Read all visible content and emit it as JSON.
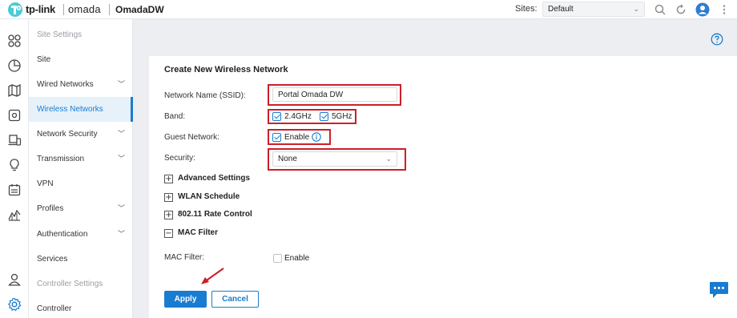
{
  "header": {
    "brand_tplink": "tp-link",
    "brand_omada": "omada",
    "site_name": "OmadaDW",
    "sites_label": "Sites:",
    "sites_value": "Default",
    "icons": [
      "search-icon",
      "refresh-icon",
      "user-avatar",
      "more-vertical-icon"
    ]
  },
  "rail": {
    "icons": [
      "dashboard-icon",
      "statistics-icon",
      "map-icon",
      "devices-icon",
      "clients-icon",
      "insights-icon",
      "logs-icon",
      "reports-icon",
      "account-icon",
      "settings-icon"
    ]
  },
  "subnav": {
    "items": [
      {
        "label": "Site Settings",
        "muted": true
      },
      {
        "label": "Site"
      },
      {
        "label": "Wired Networks",
        "chevron": "﹀"
      },
      {
        "label": "Wireless Networks",
        "active": true
      },
      {
        "label": "Network Security",
        "chevron": "﹀"
      },
      {
        "label": "Transmission",
        "chevron": "﹀"
      },
      {
        "label": "VPN"
      },
      {
        "label": "Profiles",
        "chevron": "﹀"
      },
      {
        "label": "Authentication",
        "chevron": "﹀"
      },
      {
        "label": "Services"
      },
      {
        "label": "Controller Settings",
        "muted": true
      },
      {
        "label": "Controller"
      }
    ]
  },
  "form": {
    "title": "Create New Wireless Network",
    "ssid_label": "Network Name (SSID):",
    "ssid_value": "Portal Omada DW",
    "band_label": "Band:",
    "band_24": "2.4GHz",
    "band_5": "5GHz",
    "guest_label": "Guest Network:",
    "guest_enable": "Enable",
    "security_label": "Security:",
    "security_value": "None",
    "sections": [
      {
        "label": "Advanced Settings",
        "sign": "+"
      },
      {
        "label": "WLAN Schedule",
        "sign": "+"
      },
      {
        "label": "802.11 Rate Control",
        "sign": "+"
      },
      {
        "label": "MAC Filter",
        "sign": "−"
      }
    ],
    "mac_filter_label": "MAC Filter:",
    "mac_filter_enable": "Enable",
    "apply": "Apply",
    "cancel": "Cancel"
  },
  "colors": {
    "accent": "#1a7cd0",
    "highlight": "#cc1f2a",
    "logo": "#4acbd6"
  }
}
